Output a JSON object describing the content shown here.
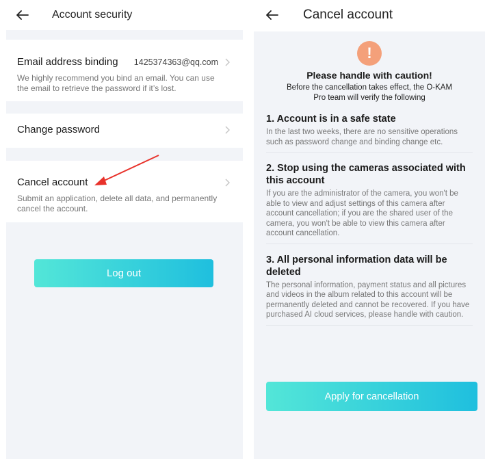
{
  "left": {
    "header": {
      "title": "Account security",
      "back_icon": "arrow-left-icon"
    },
    "email_section": {
      "title": "Email address binding",
      "value": "1425374363@qq.com",
      "description": "We highly recommend you bind an email. You can use the email to retrieve the password if it’s lost."
    },
    "password_section": {
      "title": "Change password"
    },
    "cancel_section": {
      "title": "Cancel account",
      "description": "Submit an application, delete all data, and permanently cancel the account."
    },
    "logout_button": "Log out"
  },
  "right": {
    "header": {
      "title": "Cancel account",
      "back_icon": "arrow-left-icon"
    },
    "warning": {
      "icon": "!",
      "heading": "Please handle with caution!",
      "subtext": "Before the cancellation takes effect, the O-KAM Pro team will verify the following"
    },
    "items": [
      {
        "title": "1. Account is in a safe state",
        "desc": "In the last two weeks, there are no sensitive operations such as password change and binding change etc."
      },
      {
        "title": "2. Stop using the cameras associated with this account",
        "desc": "If you are the administrator of the camera, you won't be able to view and adjust settings of this camera after account cancellation; if you are the shared user of the camera, you won't be able to view this camera after account cancellation."
      },
      {
        "title": "3. All personal information data will be deleted",
        "desc": "The personal information, payment status and all pictures and videos in the album related to this account will be permanently deleted and cannot be recovered. If you have purchased AI cloud services, please handle with caution."
      }
    ],
    "apply_button": "Apply for cancellation"
  },
  "colors": {
    "accent_start": "#53e6d8",
    "accent_end": "#1fbfde",
    "warning": "#f4a07a",
    "annotation": "#e8322b",
    "background": "#f2f4f8"
  }
}
